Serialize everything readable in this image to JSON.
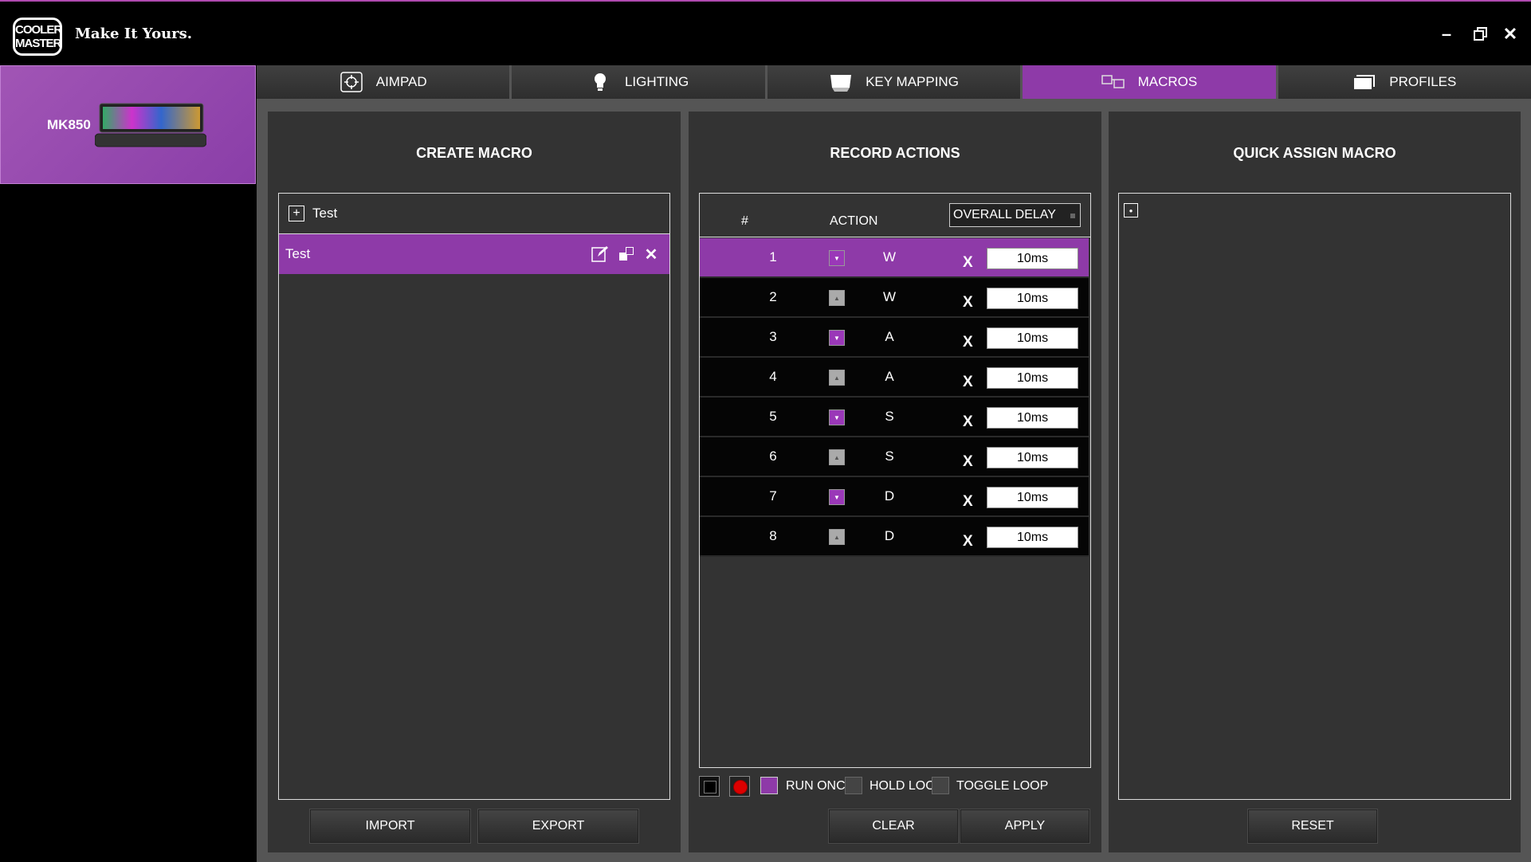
{
  "brand": {
    "logo_text": "COOLER MASTER",
    "tagline": "Make It Yours."
  },
  "window": {
    "minimize": "–",
    "restore": "❐",
    "close": "✕"
  },
  "device": {
    "name": "MK850"
  },
  "tabs": [
    {
      "label": "AIMPAD",
      "icon": "aimpad-icon"
    },
    {
      "label": "LIGHTING",
      "icon": "bulb-icon"
    },
    {
      "label": "KEY MAPPING",
      "icon": "keycap-icon"
    },
    {
      "label": "MACROS",
      "icon": "macro-icon",
      "active": true
    },
    {
      "label": "PROFILES",
      "icon": "profiles-icon"
    }
  ],
  "create_macro": {
    "title": "CREATE MACRO",
    "group_name": "Test",
    "macros": [
      {
        "name": "Test",
        "selected": true
      }
    ],
    "import_label": "IMPORT",
    "export_label": "EXPORT"
  },
  "record_actions": {
    "title": "RECORD ACTIONS",
    "col_num": "#",
    "col_action": "ACTION",
    "overall_delay": "OVERALL DELAY",
    "rows": [
      {
        "num": "1",
        "dir": "down",
        "key": "W",
        "delay": "10ms",
        "selected": true
      },
      {
        "num": "2",
        "dir": "up",
        "key": "W",
        "delay": "10ms"
      },
      {
        "num": "3",
        "dir": "down",
        "key": "A",
        "delay": "10ms"
      },
      {
        "num": "4",
        "dir": "up",
        "key": "A",
        "delay": "10ms"
      },
      {
        "num": "5",
        "dir": "down",
        "key": "S",
        "delay": "10ms"
      },
      {
        "num": "6",
        "dir": "up",
        "key": "S",
        "delay": "10ms"
      },
      {
        "num": "7",
        "dir": "down",
        "key": "D",
        "delay": "10ms"
      },
      {
        "num": "8",
        "dir": "up",
        "key": "D",
        "delay": "10ms"
      }
    ],
    "delete_glyph": "X",
    "run_once": "RUN ONCE",
    "hold_loop": "HOLD LOOP",
    "toggle_loop": "TOGGLE LOOP",
    "clear_label": "CLEAR",
    "apply_label": "APPLY"
  },
  "quick_assign": {
    "title": "QUICK ASSIGN MACRO",
    "reset_label": "RESET"
  },
  "colors": {
    "accent": "#8e3aa8",
    "panel": "#333333",
    "frame": "#555555"
  }
}
